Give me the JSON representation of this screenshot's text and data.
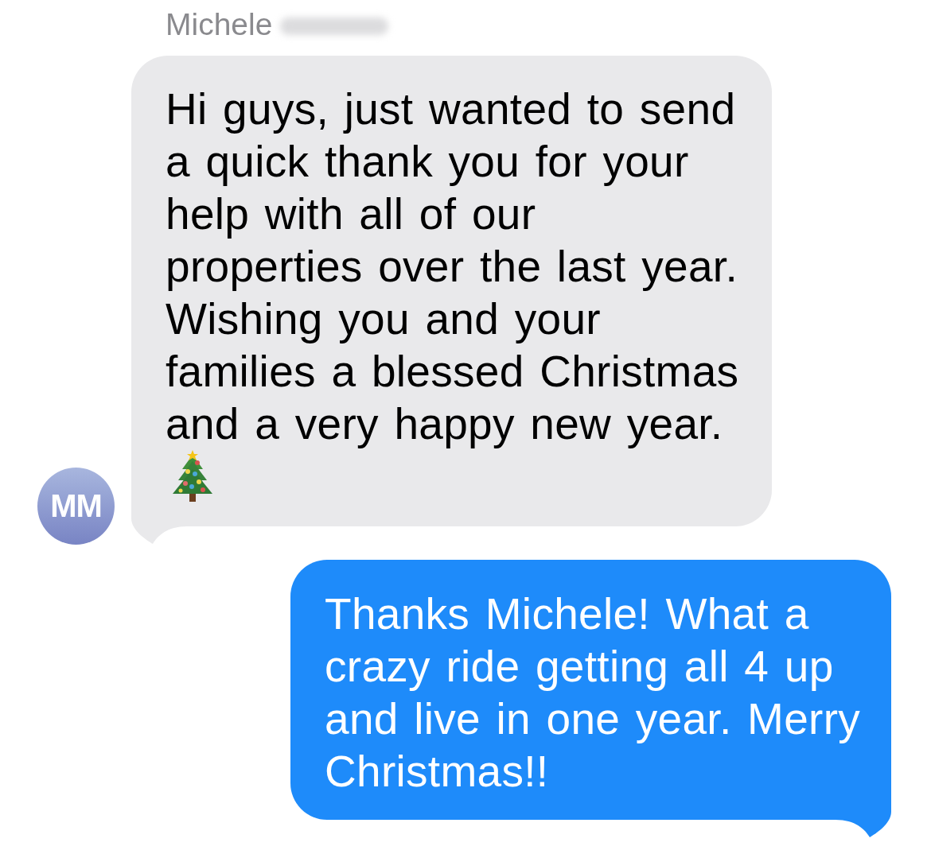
{
  "conversation": {
    "sender": {
      "name": "Michele",
      "surname_redacted": true
    },
    "messages": [
      {
        "kind": "received",
        "avatar": "MM",
        "text": "Hi guys, just wanted to send a quick thank you for your help with all of our properties over the last year. Wishing you and your families a blessed Christmas and a very happy new year.",
        "trailing_emoji": true
      },
      {
        "kind": "sent",
        "text": "Thanks Michele! What a crazy ride getting all 4 up and live in one year. Merry Christmas!!"
      }
    ]
  }
}
